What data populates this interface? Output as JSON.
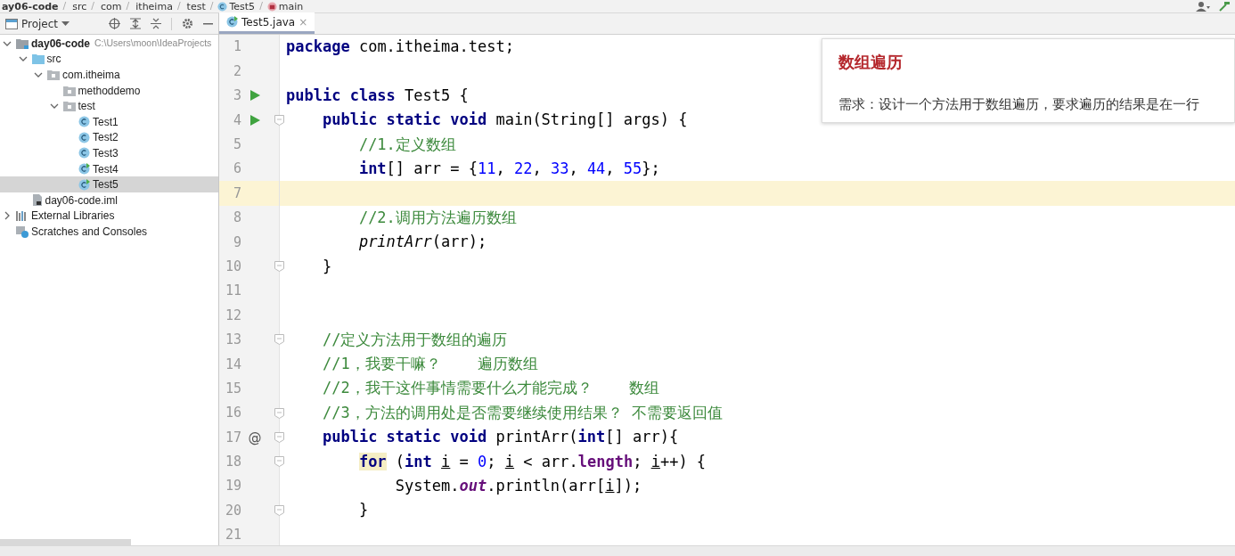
{
  "breadcrumbs": [
    {
      "label": "ay06-code",
      "kind": "module"
    },
    {
      "sep": "/",
      "label": "src",
      "kind": "folder"
    },
    {
      "sep": "/",
      "label": "com",
      "kind": "folder"
    },
    {
      "sep": "/",
      "label": "itheima",
      "kind": "folder"
    },
    {
      "sep": "/",
      "label": "test",
      "kind": "folder"
    },
    {
      "sep": "/",
      "label": "Test5",
      "kind": "class"
    },
    {
      "sep": "/",
      "label": "main",
      "kind": "method"
    }
  ],
  "project_panel": {
    "title": "Project",
    "tree": [
      {
        "label": "day06-code",
        "hint": "C:\\Users\\moon\\IdeaProjects",
        "kind": "module",
        "expanded": true,
        "selected": false,
        "children": [
          {
            "label": "src",
            "kind": "source",
            "expanded": true,
            "selected": false,
            "children": [
              {
                "label": "com.itheima",
                "kind": "package",
                "expanded": true,
                "selected": false,
                "children": [
                  {
                    "label": "methoddemo",
                    "kind": "package",
                    "selected": false
                  },
                  {
                    "label": "test",
                    "kind": "package",
                    "expanded": true,
                    "selected": false,
                    "children": [
                      {
                        "label": "Test1",
                        "kind": "class",
                        "selected": false
                      },
                      {
                        "label": "Test2",
                        "kind": "class",
                        "selected": false
                      },
                      {
                        "label": "Test3",
                        "kind": "class",
                        "selected": false
                      },
                      {
                        "label": "Test4",
                        "kind": "runnable",
                        "selected": false
                      },
                      {
                        "label": "Test5",
                        "kind": "runnable",
                        "selected": true
                      }
                    ]
                  }
                ]
              }
            ]
          },
          {
            "label": "day06-code.iml",
            "kind": "file",
            "selected": false
          }
        ]
      },
      {
        "label": "External Libraries",
        "kind": "libraries",
        "expanded": false,
        "selected": false
      },
      {
        "label": "Scratches and Consoles",
        "kind": "scratches",
        "selected": false
      }
    ]
  },
  "editor": {
    "tabs": [
      {
        "label": "Test5.java",
        "close": "×",
        "selected": true
      }
    ],
    "lines": [
      {
        "number": "1",
        "kind": "plain",
        "fold": false,
        "current": false,
        "tokens": [
          {
            "kind": "kw",
            "text": "package"
          },
          {
            "kind": "plain",
            "text": " com.itheima.test;"
          }
        ]
      },
      {
        "number": "2",
        "kind": "plain",
        "fold": false,
        "current": false
      },
      {
        "number": "3",
        "kind": "run",
        "fold": false,
        "current": false,
        "tokens": [
          {
            "kind": "kw",
            "text": "public class"
          },
          {
            "kind": "plain",
            "text": " Test5 {"
          }
        ]
      },
      {
        "number": "4",
        "kind": "run",
        "fold": true,
        "current": false,
        "tokens": [
          {
            "kind": "kw",
            "text": "    public static void"
          },
          {
            "kind": "plain",
            "text": " main(String[] args) {"
          }
        ]
      },
      {
        "number": "5",
        "kind": "plain",
        "fold": false,
        "current": false,
        "tokens": [
          {
            "kind": "comment",
            "text": "        //1.定义数组"
          }
        ]
      },
      {
        "number": "6",
        "kind": "plain",
        "fold": false,
        "current": false,
        "tokens": [
          {
            "kind": "kw",
            "text": "        int"
          },
          {
            "kind": "plain",
            "text": "[] arr = {"
          },
          {
            "kind": "num",
            "text": "11"
          },
          {
            "kind": "plain",
            "text": ", "
          },
          {
            "kind": "num",
            "text": "22"
          },
          {
            "kind": "plain",
            "text": ", "
          },
          {
            "kind": "num",
            "text": "33"
          },
          {
            "kind": "plain",
            "text": ", "
          },
          {
            "kind": "num",
            "text": "44"
          },
          {
            "kind": "plain",
            "text": ", "
          },
          {
            "kind": "num",
            "text": "55"
          },
          {
            "kind": "plain",
            "text": "};"
          }
        ]
      },
      {
        "number": "7",
        "kind": "plain",
        "fold": false,
        "current": true
      },
      {
        "number": "8",
        "kind": "plain",
        "fold": false,
        "current": false,
        "tokens": [
          {
            "kind": "comment",
            "text": "        //2.调用方法遍历数组"
          }
        ]
      },
      {
        "number": "9",
        "kind": "plain",
        "fold": false,
        "current": false,
        "tokens": [
          {
            "kind": "call",
            "text": "        printArr"
          },
          {
            "kind": "plain",
            "text": "(arr);"
          }
        ]
      },
      {
        "number": "10",
        "kind": "plain",
        "fold": true,
        "current": false,
        "tokens": [
          {
            "kind": "plain",
            "text": "    }"
          }
        ]
      },
      {
        "number": "11",
        "kind": "plain",
        "fold": false,
        "current": false
      },
      {
        "number": "12",
        "kind": "plain",
        "fold": false,
        "current": false
      },
      {
        "number": "13",
        "kind": "plain",
        "fold": true,
        "current": false,
        "tokens": [
          {
            "kind": "comment",
            "text": "    //定义方法用于数组的遍历"
          }
        ]
      },
      {
        "number": "14",
        "kind": "plain",
        "fold": false,
        "current": false,
        "tokens": [
          {
            "kind": "comment",
            "text": "    //1，我要干嘛？    遍历数组"
          }
        ]
      },
      {
        "number": "15",
        "kind": "plain",
        "fold": false,
        "current": false,
        "tokens": [
          {
            "kind": "comment",
            "text": "    //2，我干这件事情需要什么才能完成？    数组"
          }
        ]
      },
      {
        "number": "16",
        "kind": "plain",
        "fold": true,
        "current": false,
        "tokens": [
          {
            "kind": "comment",
            "text": "    //3，方法的调用处是否需要继续使用结果？ 不需要返回值"
          }
        ]
      },
      {
        "number": "17",
        "kind": "annotated",
        "marker": "@",
        "fold": true,
        "current": false,
        "tokens": [
          {
            "kind": "kw",
            "text": "    public static void"
          },
          {
            "kind": "plain",
            "text": " printArr("
          },
          {
            "kind": "kw",
            "text": "int"
          },
          {
            "kind": "plain",
            "text": "[] arr){"
          }
        ]
      },
      {
        "number": "18",
        "kind": "plain",
        "fold": true,
        "current": false,
        "tokens": [
          {
            "kind": "kw_marked",
            "text": "        for"
          },
          {
            "kind": "plain",
            "text": " ("
          },
          {
            "kind": "kw",
            "text": "int"
          },
          {
            "kind": "var",
            "text": " i"
          },
          {
            "kind": "plain",
            "text": " = "
          },
          {
            "kind": "num",
            "text": "0"
          },
          {
            "kind": "plain",
            "text": ";"
          },
          {
            "kind": "var",
            "text": " i"
          },
          {
            "kind": "plain",
            "text": " < arr."
          },
          {
            "kind": "field",
            "text": "length"
          },
          {
            "kind": "plain",
            "text": ";"
          },
          {
            "kind": "var",
            "text": " i"
          },
          {
            "kind": "plain",
            "text": "++) {"
          }
        ]
      },
      {
        "number": "19",
        "kind": "plain",
        "fold": false,
        "current": false,
        "tokens": [
          {
            "kind": "plain",
            "text": "            System."
          },
          {
            "kind": "static",
            "text": "out"
          },
          {
            "kind": "plain",
            "text": ".println(arr["
          },
          {
            "kind": "var",
            "text": "i"
          },
          {
            "kind": "plain",
            "text": "]);"
          }
        ]
      },
      {
        "number": "20",
        "kind": "plain",
        "fold": true,
        "current": false,
        "tokens": [
          {
            "kind": "plain",
            "text": "        }"
          }
        ]
      },
      {
        "number": "21",
        "kind": "plain",
        "fold": false,
        "current": false
      }
    ]
  },
  "note": {
    "title": "数组遍历",
    "body": "需求：设计一个方法用于数组遍历，要求遍历的结果是在一行"
  }
}
